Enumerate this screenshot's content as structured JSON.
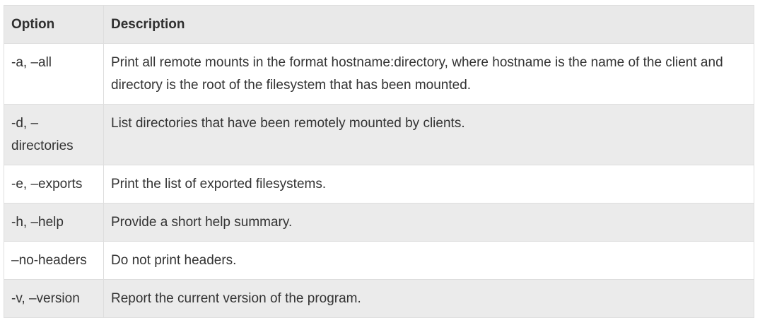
{
  "table": {
    "headers": [
      "Option",
      "Description"
    ],
    "rows": [
      {
        "option": "-a, –all",
        "description": "Print all remote mounts in the format hostname:directory, where hostname is the name of the client and directory is the root of the filesystem that has been mounted."
      },
      {
        "option": "-d, –directories",
        "description": "List directories that have been remotely mounted by clients."
      },
      {
        "option": "-e, –exports",
        "description": "Print the list of exported filesystems."
      },
      {
        "option": "-h, –help",
        "description": "Provide a short help summary."
      },
      {
        "option": "–no-headers",
        "description": "Do not print headers."
      },
      {
        "option": "-v, –version",
        "description": "Report the current version of the program."
      }
    ]
  }
}
